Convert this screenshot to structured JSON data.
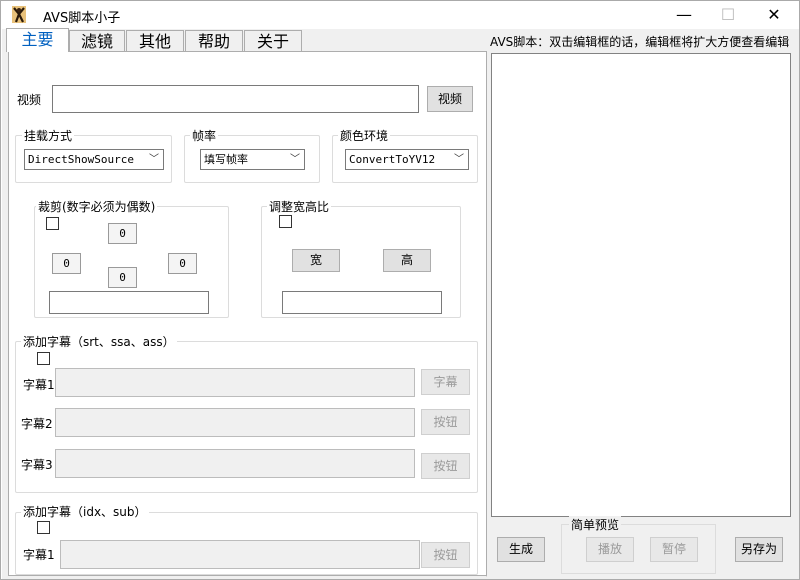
{
  "window": {
    "title": "AVS脚本小子",
    "minimize_glyph": "—",
    "maximize_glyph": "☐",
    "close_glyph": "✕"
  },
  "tabs": [
    "主要",
    "滤镜",
    "其他",
    "帮助",
    "关于"
  ],
  "main": {
    "video_label": "视频",
    "video_value": "",
    "video_button": "视频",
    "mount": {
      "title": "挂载方式",
      "selected": "DirectShowSource"
    },
    "framerate": {
      "title": "帧率",
      "selected": "填写帧率"
    },
    "colorspace": {
      "title": "颜色环境",
      "selected": "ConvertToYV12"
    },
    "crop": {
      "title": "裁剪(数字必须为偶数)",
      "top": "0",
      "left": "0",
      "right": "0",
      "bottom": "0",
      "result": ""
    },
    "aspect": {
      "title": "调整宽高比",
      "width_button": "宽",
      "height_button": "高",
      "result": ""
    },
    "subtitle_text": {
      "title": "添加字幕（srt、ssa、ass）",
      "rows": [
        {
          "label": "字幕1",
          "value": "",
          "button": "字幕"
        },
        {
          "label": "字幕2",
          "value": "",
          "button": "按钮"
        },
        {
          "label": "字幕3",
          "value": "",
          "button": "按钮"
        }
      ]
    },
    "subtitle_idx": {
      "title": "添加字幕（idx、sub）",
      "rows": [
        {
          "label": "字幕1",
          "value": "",
          "button": "按钮"
        }
      ]
    }
  },
  "editor": {
    "hint": "AVS脚本：双击编辑框的话，编辑框将扩大方便查看编辑",
    "content": ""
  },
  "bottom": {
    "generate_button": "生成",
    "preview_title": "简单预览",
    "play_button": "播放",
    "pause_button": "暂停",
    "save_as_button": "另存为"
  }
}
